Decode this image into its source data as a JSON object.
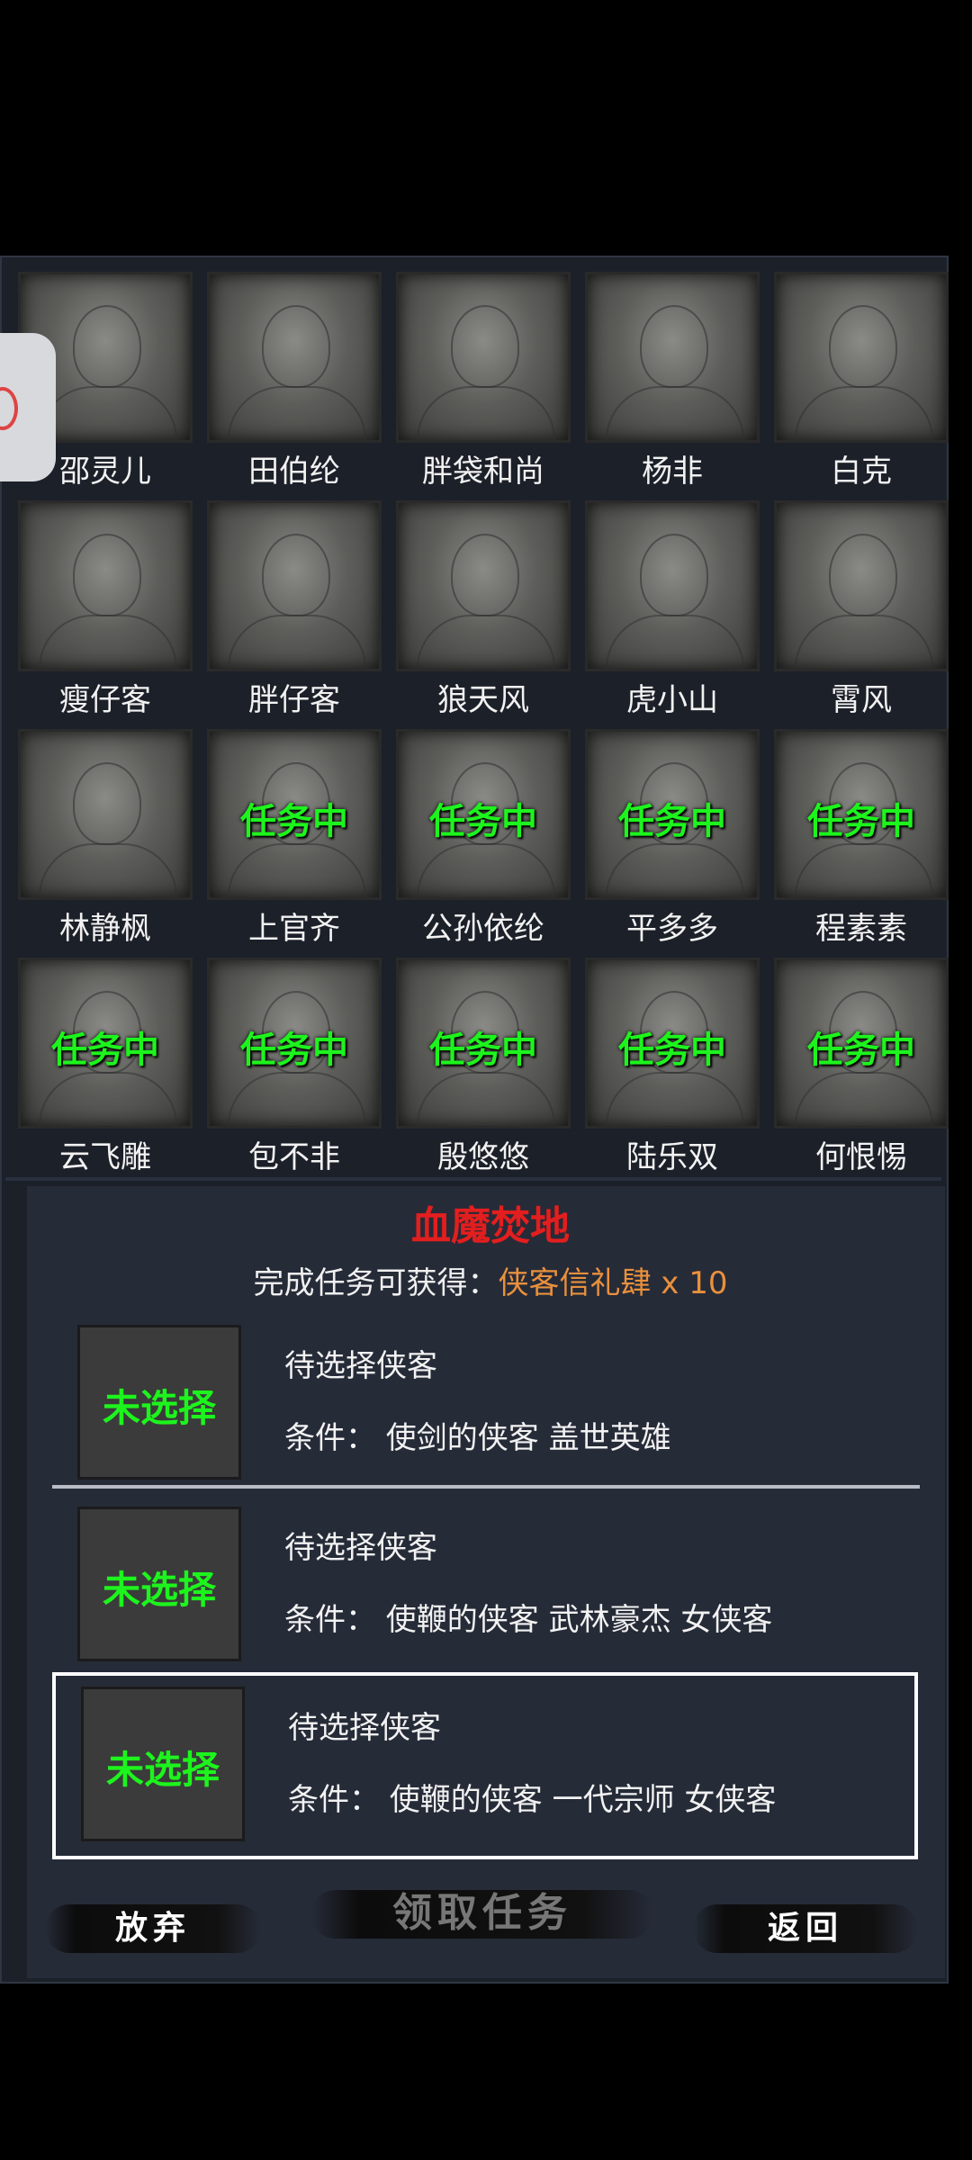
{
  "heroes": [
    {
      "name": "邵灵儿",
      "status": ""
    },
    {
      "name": "田伯纶",
      "status": ""
    },
    {
      "name": "胖袋和尚",
      "status": ""
    },
    {
      "name": "杨非",
      "status": ""
    },
    {
      "name": "白克",
      "status": ""
    },
    {
      "name": "瘦仔客",
      "status": ""
    },
    {
      "name": "胖仔客",
      "status": ""
    },
    {
      "name": "狼天风",
      "status": ""
    },
    {
      "name": "虎小山",
      "status": ""
    },
    {
      "name": "霄风",
      "status": ""
    },
    {
      "name": "林静枫",
      "status": ""
    },
    {
      "name": "上官齐",
      "status": "任务中"
    },
    {
      "name": "公孙依纶",
      "status": "任务中"
    },
    {
      "name": "平多多",
      "status": "任务中"
    },
    {
      "name": "程素素",
      "status": "任务中"
    },
    {
      "name": "云飞雕",
      "status": "任务中"
    },
    {
      "name": "包不非",
      "status": "任务中"
    },
    {
      "name": "殷悠悠",
      "status": "任务中"
    },
    {
      "name": "陆乐双",
      "status": "任务中"
    },
    {
      "name": "何恨惕",
      "status": "任务中"
    }
  ],
  "mission": {
    "title": "血魔焚地",
    "reward_prefix": "完成任务可获得：",
    "reward_value": "侠客信礼肆 x 10"
  },
  "slots": [
    {
      "status": "未选择",
      "title": "待选择侠客",
      "condition": "条件：  使剑的侠客  盖世英雄"
    },
    {
      "status": "未选择",
      "title": "待选择侠客",
      "condition": "条件：  使鞭的侠客  武林豪杰  女侠客"
    },
    {
      "status": "未选择",
      "title": "待选择侠客",
      "condition": "条件：  使鞭的侠客  一代宗师  女侠客"
    }
  ],
  "buttons": {
    "abandon": "放弃",
    "accept": "领取任务",
    "back": "返回"
  },
  "colors": {
    "status_green": "#1df41d",
    "title_red": "#e31e1e",
    "reward_orange": "#e9903d"
  }
}
